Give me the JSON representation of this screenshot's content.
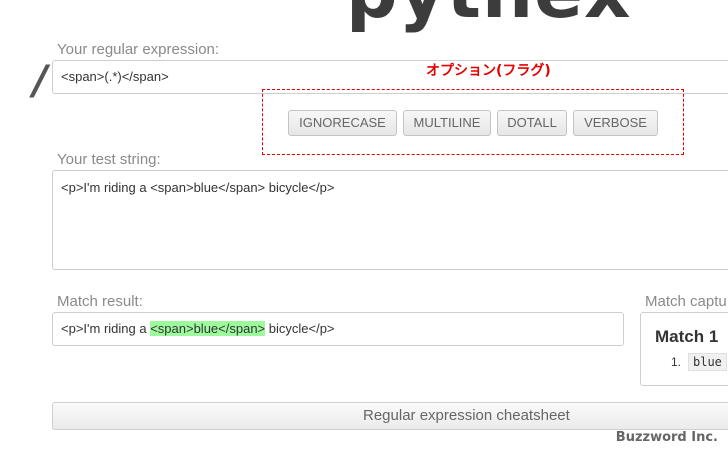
{
  "header": {
    "logo": "pythex"
  },
  "regex": {
    "label": "Your regular expression:",
    "delimiter": "/",
    "value": "<span>(.*)</span>"
  },
  "annotation": {
    "text": "オプション(フラグ)",
    "color": "#e60000"
  },
  "flags": [
    {
      "label": "IGNORECASE"
    },
    {
      "label": "MULTILINE"
    },
    {
      "label": "DOTALL"
    },
    {
      "label": "VERBOSE"
    }
  ],
  "test": {
    "label": "Your test string:",
    "value": "<p>I'm riding a <span>blue</span> bicycle</p>"
  },
  "result": {
    "label": "Match result:",
    "before": "<p>I'm riding a ",
    "match": "<span>blue</span>",
    "after": " bicycle</p>",
    "highlight_color": "#9dfa9d"
  },
  "captures": {
    "label": "Match captu",
    "match_title": "Match 1",
    "groups": [
      {
        "index": "1.",
        "value": "blue"
      }
    ]
  },
  "cheatsheet": {
    "label": "Regular expression cheatsheet"
  },
  "watermark": "Buzzword Inc."
}
